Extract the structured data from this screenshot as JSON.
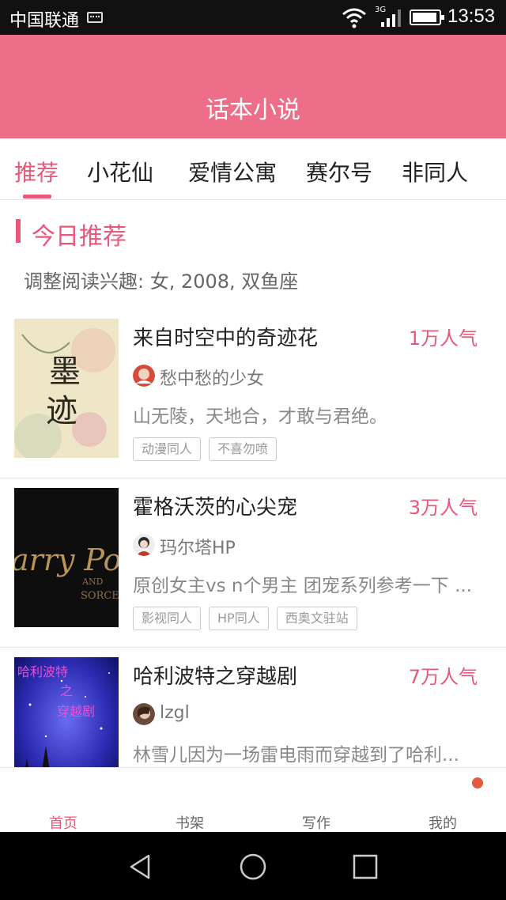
{
  "status_bar": {
    "carrier": "中国联通",
    "network": "3G",
    "time": "13:53"
  },
  "header": {
    "title": "话本小说"
  },
  "tabs": [
    {
      "label": "推荐",
      "active": true
    },
    {
      "label": "小花仙",
      "active": false
    },
    {
      "label": "爱情公寓",
      "active": false
    },
    {
      "label": "赛尔号",
      "active": false
    },
    {
      "label": "非同人",
      "active": false
    }
  ],
  "section": {
    "title": "今日推荐",
    "interest": "调整阅读兴趣: 女, 2008, 双鱼座"
  },
  "books": [
    {
      "title": "来自时空中的奇迹花",
      "popularity": "1万人气",
      "author": "愁中愁的少女",
      "description": "山无陵，天地合，才敢与君绝。",
      "tags": [
        "动漫同人",
        "不喜勿喷"
      ],
      "cover_text": "墨迹"
    },
    {
      "title": "霍格沃茨的心尖宠",
      "popularity": "3万人气",
      "author": "玛尔塔HP",
      "description": "原创女主vs n个男主 团宠系列参考一下 ...",
      "tags": [
        "影视同人",
        "HP同人",
        "西奥文驻站"
      ],
      "cover_text": "arry Pott"
    },
    {
      "title": "哈利波特之穿越剧",
      "popularity": "7万人气",
      "author": "lzgl",
      "description": "林雪儿因为一场雷电雨而穿越到了哈利...",
      "tags": [],
      "cover_text": "哈利波特之穿越剧"
    }
  ],
  "bottom_nav": [
    {
      "label": "首页",
      "active": true
    },
    {
      "label": "书架",
      "active": false
    },
    {
      "label": "写作",
      "active": false
    },
    {
      "label": "我的",
      "active": false
    }
  ],
  "colors": {
    "accent": "#e8587a",
    "header": "#ec6e88",
    "notification_dot": "#e45a3c"
  },
  "icons": [
    "wifi-icon",
    "signal-icon",
    "battery-icon",
    "back-icon",
    "home-icon",
    "recents-icon"
  ]
}
